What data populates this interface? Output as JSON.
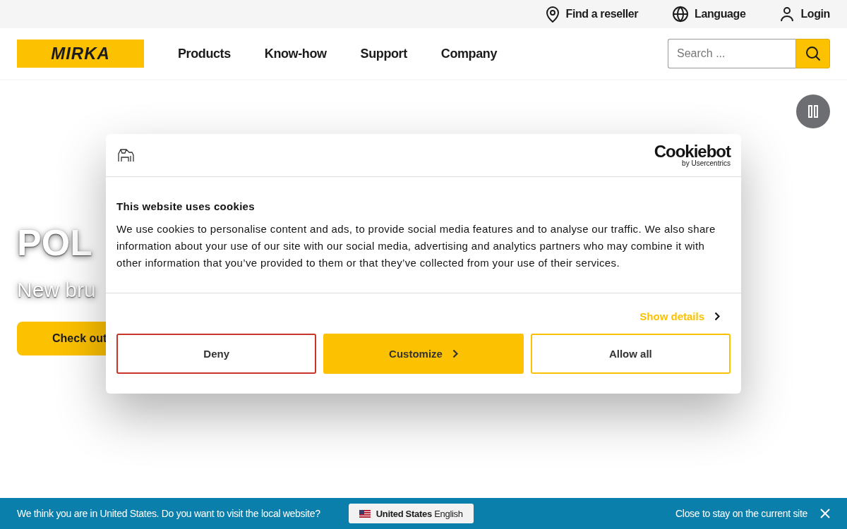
{
  "utility_bar": [
    {
      "kind": "pin",
      "label": "Find a reseller"
    },
    {
      "kind": "globe",
      "label": "Language"
    },
    {
      "kind": "user",
      "label": "Login"
    }
  ],
  "header": {
    "logo": "MIRKA",
    "nav": [
      "Products",
      "Know-how",
      "Support",
      "Company"
    ],
    "search": {
      "placeholder": "Search ..."
    }
  },
  "hero": {
    "title": "POL",
    "subtitle": "New bru",
    "button": "Check out"
  },
  "cookie_dialog": {
    "brand": "Cookiebot",
    "brand_sub": "by Usercentrics",
    "title": "This website uses cookies",
    "text": "We use cookies to personalise content and ads, to provide social media features and to analyse our traffic. We also share information about your use of our site with our social media, advertising and analytics partners who may combine it with other information that you’ve provided to them or that they’ve collected from your use of their services.",
    "show_details": "Show details",
    "buttons": [
      {
        "kind": "deny",
        "label": "Deny"
      },
      {
        "kind": "customize",
        "label": "Customize"
      },
      {
        "kind": "allow",
        "label": "Allow all"
      }
    ]
  },
  "locale_banner": {
    "message": "We think you are in United States. Do you want to visit the local website?",
    "site_button": "**United States** English",
    "close_text": "Close to stay on the current site"
  }
}
